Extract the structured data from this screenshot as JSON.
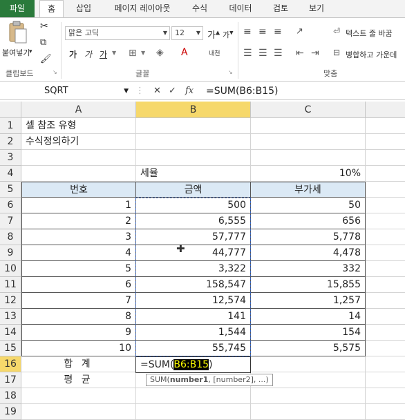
{
  "tabs": [
    "파일",
    "홈",
    "삽입",
    "페이지 레이아웃",
    "수식",
    "데이터",
    "검토",
    "보기"
  ],
  "ribbon": {
    "paste_label": "붙여넣기",
    "clipboard_label": "클립보드",
    "font_label": "글꼴",
    "align_label": "맞춤",
    "font_name": "맑은 고딕",
    "font_size": "12",
    "wrap_text": "텍스트 줄 바꿈",
    "merge_center": "병합하고 가운데",
    "bold": "가",
    "italic": "가",
    "underline": "가",
    "grow_font": "가",
    "shrink_font": "가",
    "phonetic": "내천"
  },
  "formula_bar": {
    "name_box": "SQRT",
    "formula": "=SUM(B6:B15)",
    "fx": "fx"
  },
  "columns": [
    "A",
    "B",
    "C"
  ],
  "rows": [
    {
      "n": "1",
      "a": "셀 참조 유형",
      "b": "",
      "c": ""
    },
    {
      "n": "2",
      "a": "수식정의하기",
      "b": "",
      "c": ""
    },
    {
      "n": "3",
      "a": "",
      "b": "",
      "c": ""
    },
    {
      "n": "4",
      "a": "",
      "b": "세율",
      "c": "10%"
    },
    {
      "n": "5",
      "a": "번호",
      "b": "금액",
      "c": "부가세"
    },
    {
      "n": "6",
      "a": "1",
      "b": "500",
      "c": "50"
    },
    {
      "n": "7",
      "a": "2",
      "b": "6,555",
      "c": "656"
    },
    {
      "n": "8",
      "a": "3",
      "b": "57,777",
      "c": "5,778"
    },
    {
      "n": "9",
      "a": "4",
      "b": "44,777",
      "c": "4,478"
    },
    {
      "n": "10",
      "a": "5",
      "b": "3,322",
      "c": "332"
    },
    {
      "n": "11",
      "a": "6",
      "b": "158,547",
      "c": "15,855"
    },
    {
      "n": "12",
      "a": "7",
      "b": "12,574",
      "c": "1,257"
    },
    {
      "n": "13",
      "a": "8",
      "b": "141",
      "c": "14"
    },
    {
      "n": "14",
      "a": "9",
      "b": "1,544",
      "c": "154"
    },
    {
      "n": "15",
      "a": "10",
      "b": "55,745",
      "c": "5,575"
    },
    {
      "n": "16",
      "a": "합  계",
      "b": "",
      "c": ""
    },
    {
      "n": "17",
      "a": "평  균",
      "b": "",
      "c": ""
    },
    {
      "n": "18",
      "a": "",
      "b": "",
      "c": ""
    },
    {
      "n": "19",
      "a": "",
      "b": "",
      "c": ""
    }
  ],
  "edit_cell": {
    "prefix": "=SUM(",
    "range": "B6:B15",
    "suffix": ")"
  },
  "tooltip": {
    "fn": "SUM(",
    "arg1": "number1",
    "rest": ", [number2], ...)"
  }
}
